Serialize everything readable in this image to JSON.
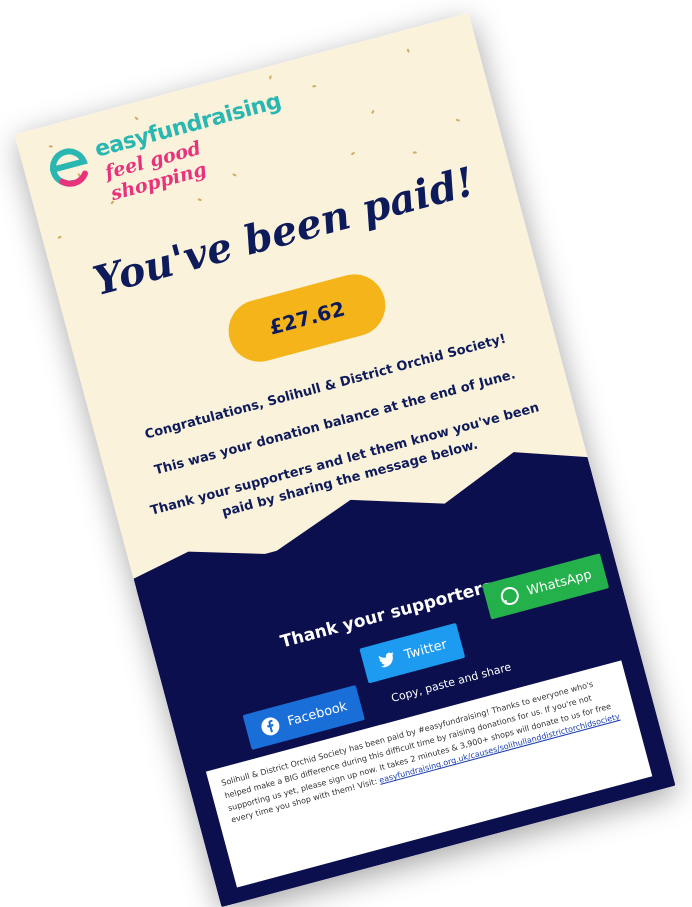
{
  "brand": {
    "name": "easyfundraising",
    "tagline": "feel good shopping",
    "colors": {
      "teal": "#2ab7b1",
      "pink": "#e8327b",
      "navy": "#0d1b5a",
      "gold": "#f4b41a",
      "dark_bg": "#0c0f4d"
    }
  },
  "headline": "You've been paid!",
  "amount": "£27.62",
  "messages": [
    "Congratulations, Solihull & District Orchid Society!",
    "This was your donation balance at the end of June.",
    "Thank your supporters and let them know you've been paid by sharing the message below."
  ],
  "share_section": {
    "title": "Thank your supporters",
    "buttons": [
      {
        "label": "Facebook",
        "icon": "facebook-icon"
      },
      {
        "label": "Twitter",
        "icon": "twitter-icon"
      },
      {
        "label": "WhatsApp",
        "icon": "whatsapp-icon"
      }
    ],
    "copy_label": "Copy, paste and share",
    "copy_text": "Solihull & District Orchid Society has been paid by #easyfundraising! Thanks to everyone who's helped make a BIG difference during this difficult time by raising donations for us. If you're not supporting us yet, please sign up now. It takes 2 minutes & 3,900+ shops will donate to us for free every time you shop with them! Visit:",
    "copy_link": "easyfundraising.org.uk/causes/solihullanddistrictorchidsociety"
  }
}
